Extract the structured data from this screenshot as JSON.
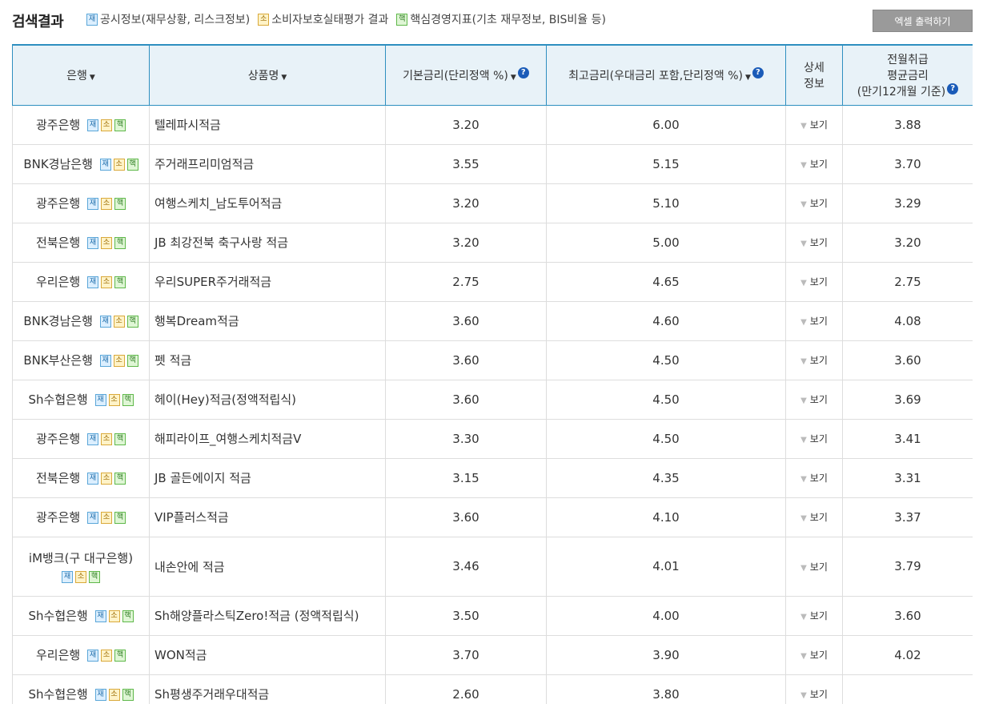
{
  "header": {
    "title": "검색결과",
    "legend": [
      {
        "badge": "재",
        "type": "jae",
        "label": "공시정보(재무상황, 리스크정보)"
      },
      {
        "badge": "소",
        "type": "so",
        "label": "소비자보호실태평가 결과"
      },
      {
        "badge": "핵",
        "type": "haek",
        "label": "핵심경영지표(기초 재무정보, BIS비율 등)"
      }
    ],
    "excel_button": "엑셀 출력하기"
  },
  "table": {
    "columns": {
      "bank": "은행",
      "product": "상품명",
      "base_rate": "기본금리(단리정액 %)",
      "max_rate": "최고금리(우대금리 포함,단리정액 %)",
      "detail_line1": "상세",
      "detail_line2": "정보",
      "avg_line1": "전월취급",
      "avg_line2": "평균금리",
      "avg_line3": "(만기12개월 기준)"
    },
    "detail_label": "보기",
    "badges": {
      "jae": "재",
      "so": "소",
      "haek": "핵"
    },
    "rows": [
      {
        "bank": "광주은행",
        "product": "텔레파시적금",
        "base": "3.20",
        "max": "6.00",
        "avg": "3.88"
      },
      {
        "bank": "BNK경남은행",
        "product": "주거래프리미엄적금",
        "base": "3.55",
        "max": "5.15",
        "avg": "3.70"
      },
      {
        "bank": "광주은행",
        "product": "여행스케치_남도투어적금",
        "base": "3.20",
        "max": "5.10",
        "avg": "3.29"
      },
      {
        "bank": "전북은행",
        "product": "JB 최강전북 축구사랑 적금",
        "base": "3.20",
        "max": "5.00",
        "avg": "3.20"
      },
      {
        "bank": "우리은행",
        "product": "우리SUPER주거래적금",
        "base": "2.75",
        "max": "4.65",
        "avg": "2.75"
      },
      {
        "bank": "BNK경남은행",
        "product": "행복Dream적금",
        "base": "3.60",
        "max": "4.60",
        "avg": "4.08"
      },
      {
        "bank": "BNK부산은행",
        "product": "펫 적금",
        "base": "3.60",
        "max": "4.50",
        "avg": "3.60"
      },
      {
        "bank": "Sh수협은행",
        "product": "헤이(Hey)적금(정액적립식)",
        "base": "3.60",
        "max": "4.50",
        "avg": "3.69"
      },
      {
        "bank": "광주은행",
        "product": "해피라이프_여행스케치적금V",
        "base": "3.30",
        "max": "4.50",
        "avg": "3.41"
      },
      {
        "bank": "전북은행",
        "product": "JB 골든에이지 적금",
        "base": "3.15",
        "max": "4.35",
        "avg": "3.31"
      },
      {
        "bank": "광주은행",
        "product": "VIP플러스적금",
        "base": "3.60",
        "max": "4.10",
        "avg": "3.37"
      },
      {
        "bank": "iM뱅크(구 대구은행)",
        "product": "내손안에 적금",
        "base": "3.46",
        "max": "4.01",
        "avg": "3.79",
        "wrap": true
      },
      {
        "bank": "Sh수협은행",
        "product": "Sh해양플라스틱Zero!적금 (정액적립식)",
        "base": "3.50",
        "max": "4.00",
        "avg": "3.60"
      },
      {
        "bank": "우리은행",
        "product": "WON적금",
        "base": "3.70",
        "max": "3.90",
        "avg": "4.02"
      },
      {
        "bank": "Sh수협은행",
        "product": "Sh평생주거래우대적금",
        "base": "2.60",
        "max": "3.80",
        "avg": ""
      }
    ]
  }
}
